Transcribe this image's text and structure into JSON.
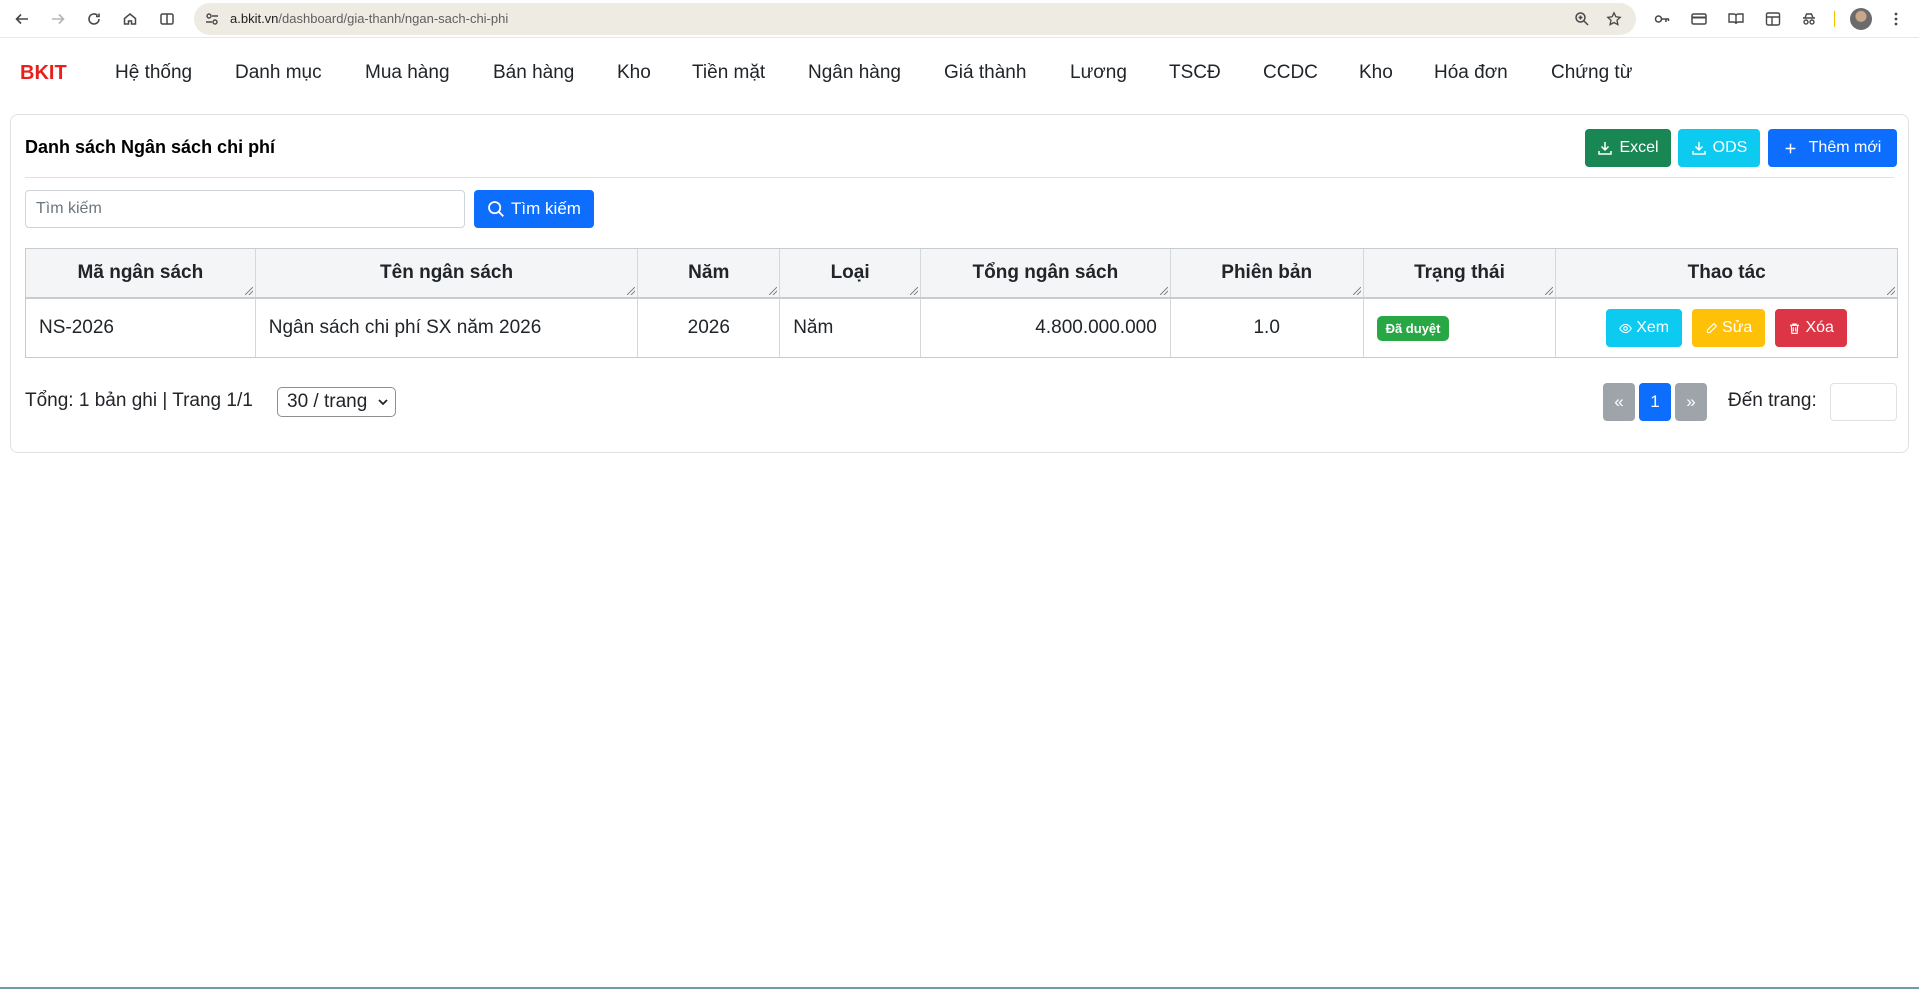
{
  "browser": {
    "url_host": "a.bkit.vn",
    "url_path": "/dashboard/gia-thanh/ngan-sach-chi-phi"
  },
  "nav": {
    "brand": "BKIT",
    "items": [
      "Hệ thống",
      "Danh mục",
      "Mua hàng",
      "Bán hàng",
      "Kho",
      "Tiền mặt",
      "Ngân hàng",
      "Giá thành",
      "Lương",
      "TSCĐ",
      "CCDC",
      "Kho",
      "Hóa đơn",
      "Chứng từ"
    ]
  },
  "page": {
    "title": "Danh sách Ngân sách chi phí",
    "excel_label": "Excel",
    "ods_label": "ODS",
    "add_label": "Thêm mới",
    "search_placeholder": "Tìm kiếm",
    "search_button": "Tìm kiếm"
  },
  "table": {
    "headers": [
      "Mã ngân sách",
      "Tên ngân sách",
      "Năm",
      "Loại",
      "Tổng ngân sách",
      "Phiên bản",
      "Trạng thái",
      "Thao tác"
    ],
    "rows": [
      {
        "code": "NS-2026",
        "name": "Ngân sách chi phí SX năm 2026",
        "year": "2026",
        "type": "Năm",
        "total": "4.800.000.000",
        "version": "1.0",
        "status": "Đã duyệt",
        "view": "Xem",
        "edit": "Sửa",
        "delete": "Xóa"
      }
    ]
  },
  "footer": {
    "summary": "Tổng: 1 bản ghi | Trang 1/1",
    "per_page": "30 / trang",
    "prev": "«",
    "current_page": "1",
    "next": "»",
    "goto_label": "Đến trang:"
  },
  "colors": {
    "brand": "#e8201d",
    "excel": "#198754",
    "ods": "#0dcaf0",
    "primary": "#0d6efd",
    "status_approved": "#28a745",
    "edit": "#ffc107",
    "delete": "#dc3545"
  }
}
